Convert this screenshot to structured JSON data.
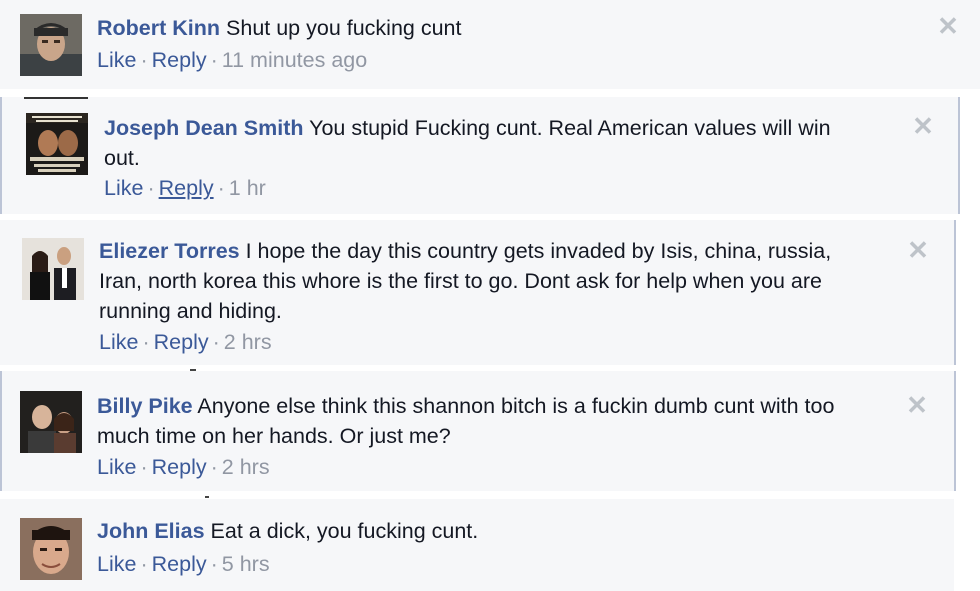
{
  "comments": [
    {
      "author": "Robert Kinn",
      "text": "Shut up you fucking cunt",
      "like": "Like",
      "reply": "Reply",
      "time": "11 minutes ago"
    },
    {
      "author": "Joseph Dean Smith",
      "text": "You stupid Fucking cunt. Real American values will win",
      "text_line2": "out.",
      "like": "Like",
      "reply": "Reply",
      "time": "1 hr"
    },
    {
      "author": "Eliezer Torres",
      "text": "I hope the day this country gets invaded by Isis, china, russia,",
      "text_line2": "Iran, north korea this whore is the first to go. Dont ask for help when you are",
      "text_line3": "running and hiding.",
      "like": "Like",
      "reply": "Reply",
      "time": "2 hrs"
    },
    {
      "author": "Billy Pike",
      "text": "Anyone else think this shannon bitch is a fuckin dumb cunt with too",
      "text_line2": "much time on her hands. Or just me?",
      "like": "Like",
      "reply": "Reply",
      "time": "2 hrs"
    },
    {
      "author": "John Elias",
      "text": "Eat a dick, you fucking cunt.",
      "like": "Like",
      "reply": "Reply",
      "time": "5 hrs"
    }
  ],
  "separator": "·",
  "close_glyph": "✕",
  "colors": {
    "author": "#3b5998",
    "meta": "#9197a3",
    "background": "#f6f7f9",
    "close": "#bec3c9"
  },
  "icons": {
    "avatar_1": "avatar-photo",
    "avatar_2": "avatar-poster-image",
    "avatar_3": "avatar-couple-photo",
    "avatar_4": "avatar-couple-photo",
    "avatar_5": "avatar-face-photo",
    "remove": "close-icon"
  }
}
